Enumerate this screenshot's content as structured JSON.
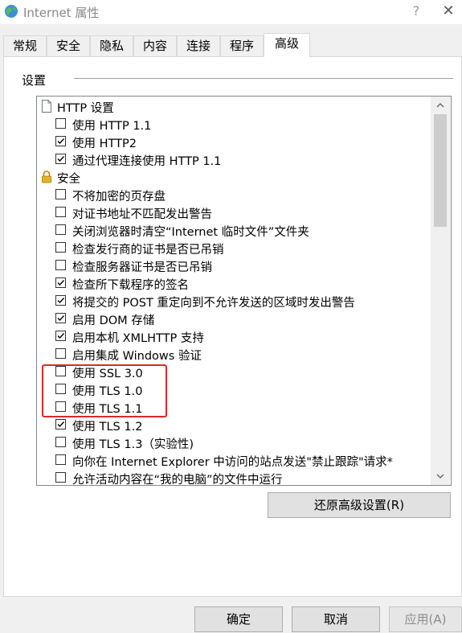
{
  "window": {
    "title": "Internet 属性",
    "help": "?",
    "close": "✕"
  },
  "tabs": [
    {
      "label": "常规",
      "active": false
    },
    {
      "label": "安全",
      "active": false
    },
    {
      "label": "隐私",
      "active": false
    },
    {
      "label": "内容",
      "active": false
    },
    {
      "label": "连接",
      "active": false
    },
    {
      "label": "程序",
      "active": false
    },
    {
      "label": "高级",
      "active": true
    }
  ],
  "settings": {
    "group_label": "设置",
    "items": [
      {
        "type": "category",
        "icon": "page-icon",
        "label": "HTTP 设置"
      },
      {
        "type": "checkbox",
        "label": "使用 HTTP 1.1",
        "checked": false
      },
      {
        "type": "checkbox",
        "label": "使用 HTTP2",
        "checked": true
      },
      {
        "type": "checkbox",
        "label": "通过代理连接使用 HTTP 1.1",
        "checked": true
      },
      {
        "type": "category",
        "icon": "lock-icon",
        "label": "安全"
      },
      {
        "type": "checkbox",
        "label": "不将加密的页存盘",
        "checked": false
      },
      {
        "type": "checkbox",
        "label": "对证书地址不匹配发出警告",
        "checked": false
      },
      {
        "type": "checkbox",
        "label": "关闭浏览器时清空“Internet 临时文件”文件夹",
        "checked": false
      },
      {
        "type": "checkbox",
        "label": "检查发行商的证书是否已吊销",
        "checked": false
      },
      {
        "type": "checkbox",
        "label": "检查服务器证书是否已吊销",
        "checked": false
      },
      {
        "type": "checkbox",
        "label": "检查所下载程序的签名",
        "checked": true
      },
      {
        "type": "checkbox",
        "label": "将提交的 POST 重定向到不允许发送的区域时发出警告",
        "checked": true
      },
      {
        "type": "checkbox",
        "label": "启用 DOM 存储",
        "checked": true
      },
      {
        "type": "checkbox",
        "label": "启用本机 XMLHTTP 支持",
        "checked": true
      },
      {
        "type": "checkbox",
        "label": "启用集成 Windows 验证",
        "checked": false
      },
      {
        "type": "checkbox",
        "label": "使用 SSL 3.0",
        "checked": false
      },
      {
        "type": "checkbox",
        "label": "使用 TLS 1.0",
        "checked": false
      },
      {
        "type": "checkbox",
        "label": "使用 TLS 1.1",
        "checked": false
      },
      {
        "type": "checkbox",
        "label": "使用 TLS 1.2",
        "checked": true
      },
      {
        "type": "checkbox",
        "label": "使用 TLS 1.3（实验性)",
        "checked": false
      },
      {
        "type": "checkbox",
        "label": "向你在 Internet Explorer 中访问的站点发送\"禁止跟踪\"请求*",
        "checked": false
      },
      {
        "type": "checkbox",
        "label": "允许活动内容在“我的电脑”的文件中运行",
        "checked": false
      }
    ]
  },
  "restore_button": "还原高级设置(R)",
  "footer": {
    "ok": "确定",
    "cancel": "取消",
    "apply": "应用(A)"
  },
  "colors": {
    "highlight": "#e0262d",
    "checkmark": "#000000"
  }
}
